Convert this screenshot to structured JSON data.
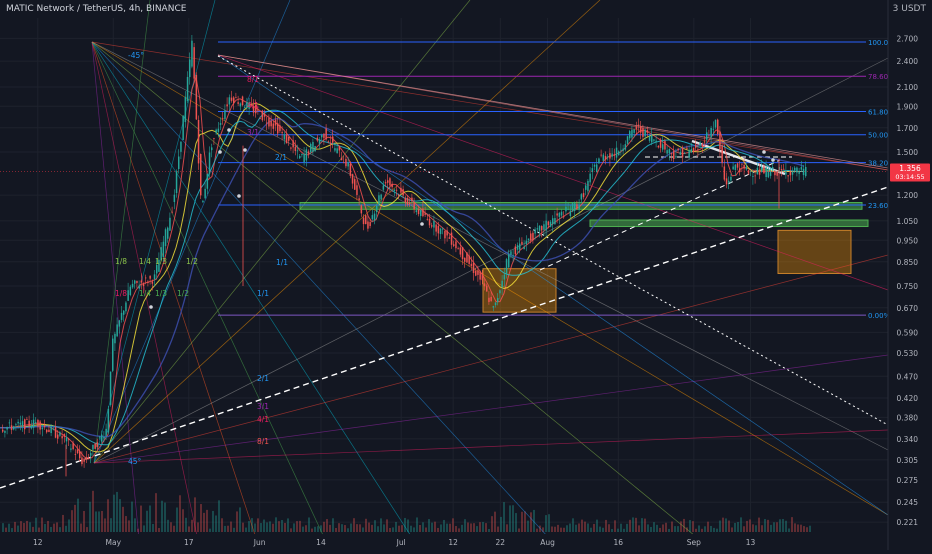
{
  "header": {
    "symbol": "MATIC Network / TetherUS, 4h, BINANCE",
    "unit": "3 USDT"
  },
  "current_price": {
    "value": "1.356",
    "countdown": "03:14:55",
    "color": "#f23645"
  },
  "colors": {
    "background": "#131722",
    "axis_text": "#b2b5be",
    "fib_blue": "#2962ff",
    "fib_purple": "#9c27b0",
    "fib_label": "#2196f3",
    "support_zone": "#4caf50",
    "target_box": "#ff9800",
    "candle_up": "#26a69a",
    "candle_down": "#ef5350"
  },
  "chart_data": {
    "type": "candlestick",
    "title": "MATIC Network / TetherUS, 4h, BINANCE",
    "y_scale": "log",
    "ylim": [
      0.21,
      3.0
    ],
    "y_ticks": [
      "2.700",
      "2.400",
      "2.100",
      "1.900",
      "1.700",
      "1.500",
      "1.200",
      "1.050",
      "0.950",
      "0.850",
      "0.750",
      "0.670",
      "0.590",
      "0.530",
      "0.470",
      "0.420",
      "0.380",
      "0.340",
      "0.305",
      "0.275",
      "0.245",
      "0.221"
    ],
    "x_ticks": [
      "12",
      "May",
      "17",
      "Jun",
      "14",
      "Jul",
      "12",
      "22",
      "Aug",
      "16",
      "Sep",
      "13"
    ],
    "price_path": [
      {
        "x": "Apr 05",
        "y": 0.36
      },
      {
        "x": "Apr 12",
        "y": 0.37
      },
      {
        "x": "Apr 18",
        "y": 0.34
      },
      {
        "x": "Apr 22",
        "y": 0.3
      },
      {
        "x": "Apr 27",
        "y": 0.36
      },
      {
        "x": "May 01",
        "y": 0.55
      },
      {
        "x": "May 05",
        "y": 0.75
      },
      {
        "x": "May 10",
        "y": 0.78
      },
      {
        "x": "May 14",
        "y": 1.15
      },
      {
        "x": "May 18",
        "y": 2.65
      },
      {
        "x": "May 20",
        "y": 1.1
      },
      {
        "x": "May 22",
        "y": 1.55
      },
      {
        "x": "May 26",
        "y": 2.0
      },
      {
        "x": "May 30",
        "y": 1.9
      },
      {
        "x": "Jun 05",
        "y": 1.7
      },
      {
        "x": "Jun 10",
        "y": 1.45
      },
      {
        "x": "Jun 15",
        "y": 1.65
      },
      {
        "x": "Jun 20",
        "y": 1.4
      },
      {
        "x": "Jun 24",
        "y": 1.0
      },
      {
        "x": "Jun 28",
        "y": 1.3
      },
      {
        "x": "Jul 05",
        "y": 1.1
      },
      {
        "x": "Jul 12",
        "y": 0.95
      },
      {
        "x": "Jul 18",
        "y": 0.78
      },
      {
        "x": "Jul 21",
        "y": 0.66
      },
      {
        "x": "Jul 24",
        "y": 0.88
      },
      {
        "x": "Jul 28",
        "y": 0.95
      },
      {
        "x": "Aug 02",
        "y": 1.05
      },
      {
        "x": "Aug 08",
        "y": 1.15
      },
      {
        "x": "Aug 12",
        "y": 1.45
      },
      {
        "x": "Aug 16",
        "y": 1.5
      },
      {
        "x": "Aug 20",
        "y": 1.7
      },
      {
        "x": "Aug 24",
        "y": 1.6
      },
      {
        "x": "Aug 28",
        "y": 1.48
      },
      {
        "x": "Sep 02",
        "y": 1.52
      },
      {
        "x": "Sep 06",
        "y": 1.75
      },
      {
        "x": "Sep 08",
        "y": 1.25
      },
      {
        "x": "Sep 10",
        "y": 1.4
      },
      {
        "x": "Sep 13",
        "y": 1.356
      }
    ],
    "fib_retracement": [
      {
        "label": "100.00%",
        "value": 2.65
      },
      {
        "label": "78.60%",
        "value": 2.22
      },
      {
        "label": "61.80%",
        "value": 1.85
      },
      {
        "label": "50.00%",
        "value": 1.64
      },
      {
        "label": "38.20%",
        "value": 1.42
      },
      {
        "label": "23.60%",
        "value": 1.14
      },
      {
        "label": "0.00%",
        "value": 0.645
      }
    ],
    "gann_fan_labels": [
      "-45°",
      "8/1",
      "4/1",
      "3/1",
      "2/1",
      "1/1",
      "1/1",
      "1/8",
      "1/4",
      "1/3",
      "1/2",
      "1/8",
      "1/4",
      "1/3",
      "1/2",
      "2/1",
      "3/1",
      "4/1",
      "8/1",
      "45°"
    ]
  }
}
